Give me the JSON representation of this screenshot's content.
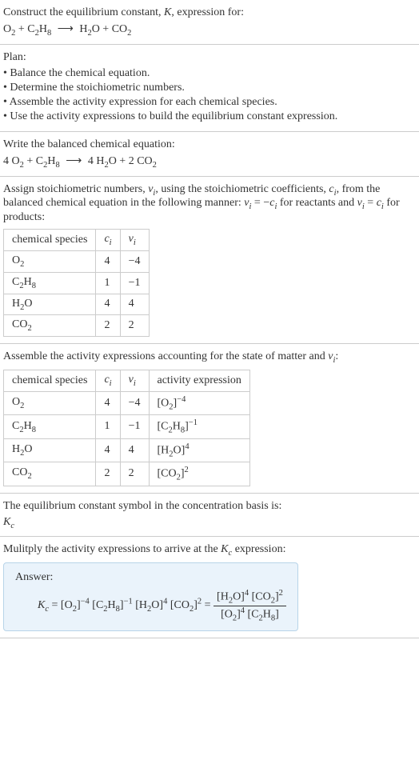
{
  "intro": {
    "line1_prefix": "Construct the equilibrium constant, ",
    "K": "K",
    "line1_suffix": ", expression for:"
  },
  "plan": {
    "title": "Plan:",
    "items": [
      "• Balance the chemical equation.",
      "• Determine the stoichiometric numbers.",
      "• Assemble the activity expression for each chemical species.",
      "• Use the activity expressions to build the equilibrium constant expression."
    ]
  },
  "balanced": {
    "title": "Write the balanced chemical equation:"
  },
  "assign": {
    "prefix": "Assign stoichiometric numbers, ",
    "nu_i": "ν",
    "mid1": ", using the stoichiometric coefficients, ",
    "c_i": "c",
    "mid2": ", from the balanced chemical equation in the following manner: ",
    "rel1_a": "ν",
    "rel1_eq": " = −",
    "rel1_b": "c",
    "mid3": " for reactants and ",
    "rel2_a": "ν",
    "rel2_eq": " = ",
    "rel2_b": "c",
    "suffix": " for products:",
    "i": "i"
  },
  "table1": {
    "h1": "chemical species",
    "h2": "c",
    "h3": "ν",
    "rows": [
      {
        "c": "4",
        "v": "−4"
      },
      {
        "c": "1",
        "v": "−1"
      },
      {
        "c": "4",
        "v": "4"
      },
      {
        "c": "2",
        "v": "2"
      }
    ]
  },
  "assemble": {
    "prefix": "Assemble the activity expressions accounting for the state of matter and ",
    "suffix": ":"
  },
  "table2": {
    "h1": "chemical species",
    "h2": "c",
    "h3": "ν",
    "h4": "activity expression",
    "rows": [
      {
        "c": "4",
        "v": "−4",
        "exp": "−4"
      },
      {
        "c": "1",
        "v": "−1",
        "exp": "−1"
      },
      {
        "c": "4",
        "v": "4",
        "exp": "4"
      },
      {
        "c": "2",
        "v": "2",
        "exp": "2"
      }
    ]
  },
  "symbol": {
    "line": "The equilibrium constant symbol in the concentration basis is:",
    "K": "K",
    "c": "c"
  },
  "multiply": {
    "prefix": "Mulitply the activity expressions to arrive at the ",
    "K": "K",
    "c": "c",
    "suffix": " expression:"
  },
  "answer": {
    "label": "Answer:",
    "eq": " = "
  }
}
